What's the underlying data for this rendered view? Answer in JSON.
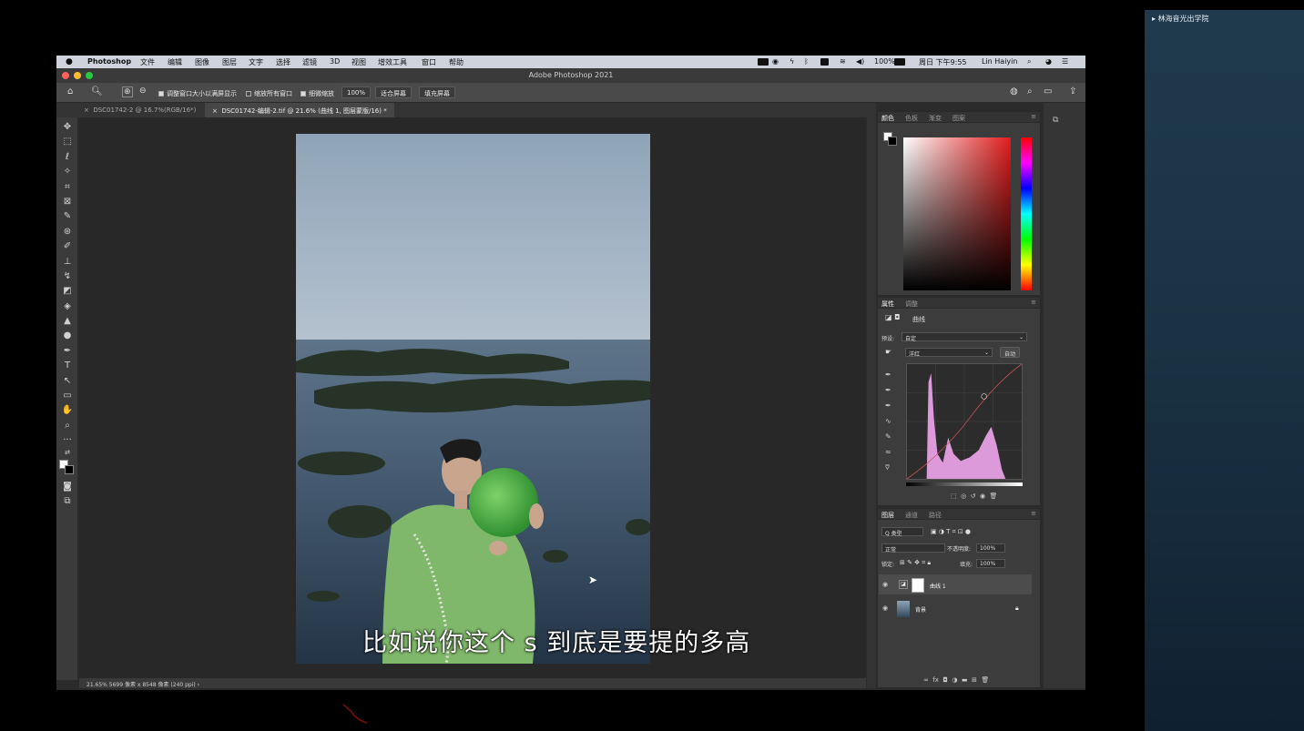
{
  "sidebar": {
    "label": "林海音光出学院"
  },
  "menubar": {
    "app_name": "Photoshop",
    "menus": [
      "文件",
      "编辑",
      "图像",
      "图层",
      "文字",
      "选择",
      "滤镜",
      "3D",
      "视图",
      "增效工具",
      "窗口",
      "帮助"
    ],
    "battery": "100%",
    "clock": "周日 下午9:55",
    "user": "Lin Haiyin"
  },
  "window": {
    "title": "Adobe Photoshop 2021"
  },
  "options": {
    "resize_windows": "调整窗口大小以满屏显示",
    "zoom_all": "缩放所有窗口",
    "scrubby_zoom": "细微缩放",
    "zoom_value": "100%",
    "fit_screen": "适合屏幕",
    "fill_screen": "填充屏幕"
  },
  "tabs": [
    {
      "label": "DSC01742-2 @ 16.7%(RGB/16*)",
      "close": "×"
    },
    {
      "label": "DSC01742-编辑-2.tif @ 21.6% (曲线 1, 图层蒙版/16) *",
      "close": "×"
    }
  ],
  "status": {
    "text": "21.65%   5699 像素 x 8548 像素 (240 ppi)  ›"
  },
  "color_panel": {
    "tabs": [
      "颜色",
      "色板",
      "渐变",
      "图案"
    ]
  },
  "properties_panel": {
    "tabs": [
      "属性",
      "调整"
    ],
    "adjustment_name": "曲线",
    "preset_label": "预设:",
    "preset_value": "自定",
    "channel_value": "洋红",
    "auto_label": "自动"
  },
  "layers_panel": {
    "tabs": [
      "图层",
      "通道",
      "路径"
    ],
    "filter_kind": "Q 类型",
    "blend_mode": "正常",
    "opacity_label": "不透明度:",
    "opacity_value": "100%",
    "lock_label": "锁定:",
    "fill_label": "填充:",
    "fill_value": "100%",
    "layers": [
      {
        "name": "曲线 1"
      },
      {
        "name": "背景"
      }
    ]
  },
  "subtitle": {
    "text": "比如说你这个 s 到底是要提的多高"
  }
}
